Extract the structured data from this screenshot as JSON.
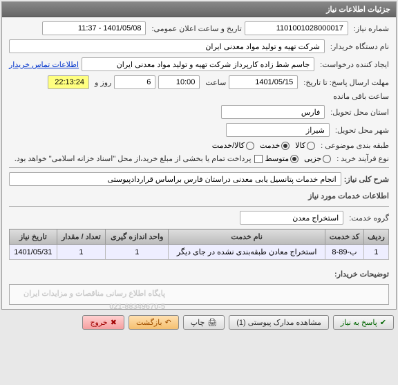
{
  "header": {
    "title": "جزئیات اطلاعات نیاز"
  },
  "fields": {
    "need_no_label": "شماره نیاز:",
    "need_no": "1101001028000017",
    "announce_label": "تاریخ و ساعت اعلان عمومی:",
    "announce_value": "1401/05/08 - 11:37",
    "org_label": "نام دستگاه خریدار:",
    "org_value": "شرکت تهیه و تولید مواد معدنی ایران",
    "requester_label": "ایجاد کننده درخواست:",
    "requester_value": "جاسم شط زاده کارپرداز شرکت تهیه و تولید مواد معدنی ایران",
    "contact_link": "اطلاعات تماس خریدار",
    "deadline_label": "مهلت ارسال پاسخ: تا تاریخ:",
    "deadline_date": "1401/05/15",
    "time_label": "ساعت",
    "deadline_time": "10:00",
    "days_sep": "روز و",
    "days_left": "6",
    "countdown": "22:13:24",
    "remaining_label": "ساعت باقی مانده",
    "province_label": "استان محل تحویل:",
    "province": "فارس",
    "city_label": "شهر محل تحویل:",
    "city": "شیراز",
    "class_label": "طبقه بندی موضوعی :",
    "class_goods": "کالا",
    "class_service": "خدمت",
    "class_both": "کالا/خدمت",
    "buy_type_label": "نوع فرآیند خرید :",
    "buy_small": "جزیی",
    "buy_medium": "متوسط",
    "pay_note": "پرداخت تمام یا بخشی از مبلغ خرید،از محل \"اسناد خزانه اسلامی\" خواهد بود.",
    "summary_label": "شرح کلی نیاز:",
    "summary": "انجام خدمات پتانسیل یابی معدنی دراستان فارس براساس قراردادپیوستی",
    "services_header": "اطلاعات خدمات مورد نیاز",
    "group_label": "گروه خدمت:",
    "group_value": "استخراج معدن",
    "buyer_notes_label": "توضیحات خریدار:",
    "watermark1": "پایگاه اطلاع رسانی مناقصات و مزایدات ایران",
    "watermark2": "021-88349670-5"
  },
  "table": {
    "cols": [
      "ردیف",
      "کد خدمت",
      "نام خدمت",
      "واحد اندازه گیری",
      "تعداد / مقدار",
      "تاریخ نیاز"
    ],
    "rows": [
      {
        "idx": "1",
        "code": "ب-89-8",
        "name": "استخراج معادن طبقه‌بندی نشده در جای دیگر",
        "unit": "1",
        "qty": "1",
        "date": "1401/05/31"
      }
    ]
  },
  "footer": {
    "respond": "پاسخ به نیاز",
    "attachments": "مشاهده مدارک پیوستی (1)",
    "print": "چاپ",
    "back": "بازگشت",
    "exit": "خروج"
  }
}
